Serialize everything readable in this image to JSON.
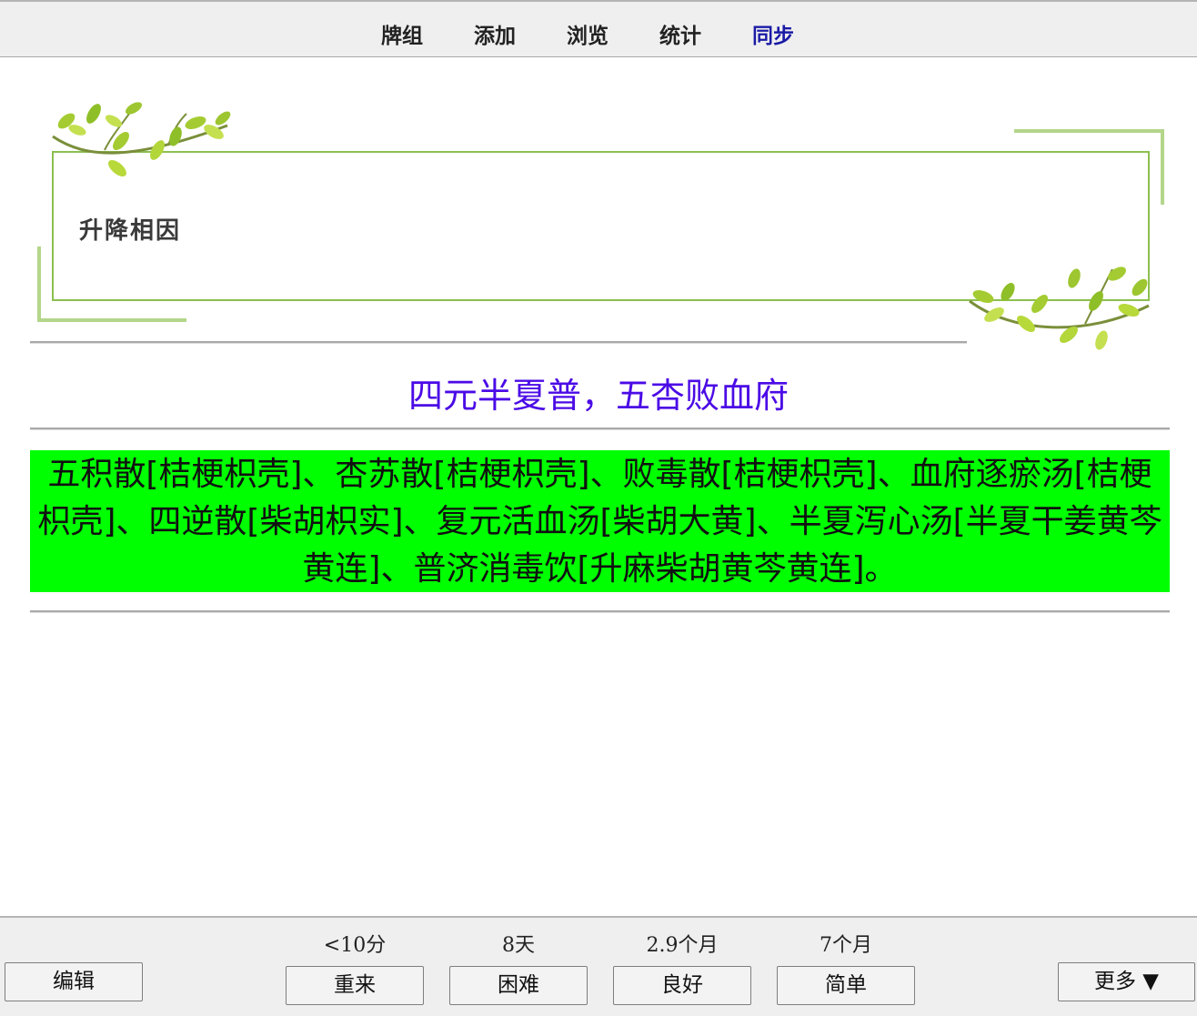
{
  "toolbar": {
    "decks": "牌组",
    "add": "添加",
    "browse": "浏览",
    "stats": "统计",
    "sync": "同步"
  },
  "card": {
    "deck_title": "升降相因",
    "question": "四元半夏普，五杏败血府",
    "answer": "五积散[桔梗枳壳]、杏苏散[桔梗枳壳]、败毒散[桔梗枳壳]、血府逐瘀汤[桔梗枳壳]、四逆散[柴胡枳实]、复元活血汤[柴胡大黄]、半夏泻心汤[半夏干姜黄芩黄连]、普济消毒饮[升麻柴胡黄芩黄连]。",
    "answer_bg": "#00ff00",
    "question_color": "#4b0ae6",
    "frame_color": "#8cbf50"
  },
  "review": {
    "edit_label": "编辑",
    "more_label": "更多 ▼",
    "answers": [
      {
        "interval": "<10分",
        "label": "重来"
      },
      {
        "interval": "8天",
        "label": "困难"
      },
      {
        "interval": "2.9个月",
        "label": "良好"
      },
      {
        "interval": "7个月",
        "label": "简单"
      }
    ]
  },
  "icons": [
    "leaf-branch-icon"
  ]
}
